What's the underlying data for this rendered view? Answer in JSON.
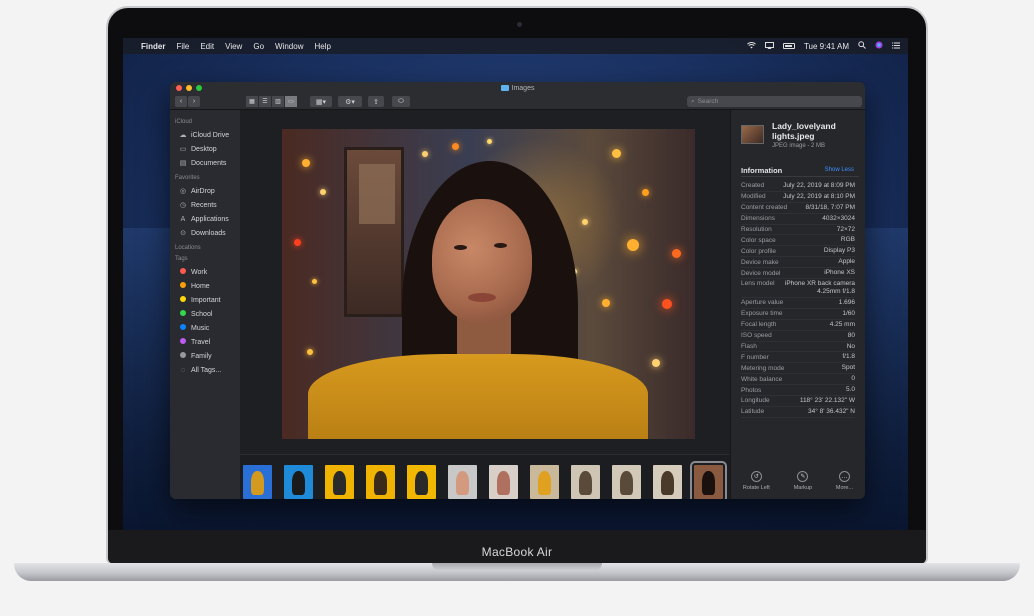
{
  "menubar": {
    "app": "Finder",
    "items": [
      "File",
      "Edit",
      "View",
      "Go",
      "Window",
      "Help"
    ],
    "time": "Tue 9:41 AM"
  },
  "window": {
    "title": "Images",
    "search_placeholder": "Search"
  },
  "sidebar": {
    "icloud_header": "iCloud",
    "icloud": [
      "iCloud Drive",
      "Desktop",
      "Documents"
    ],
    "favorites_header": "Favorites",
    "favorites": [
      "AirDrop",
      "Recents",
      "Applications",
      "Downloads"
    ],
    "locations_header": "Locations",
    "tags_header": "Tags",
    "tags": [
      {
        "label": "Work",
        "color": "#ff5a52"
      },
      {
        "label": "Home",
        "color": "#ff9f0a"
      },
      {
        "label": "Important",
        "color": "#ffd60a"
      },
      {
        "label": "School",
        "color": "#32d74b"
      },
      {
        "label": "Music",
        "color": "#0a84ff"
      },
      {
        "label": "Travel",
        "color": "#bf5af2"
      },
      {
        "label": "Family",
        "color": "#98989d"
      },
      {
        "label": "All Tags...",
        "color": ""
      }
    ]
  },
  "inspector": {
    "file_name": "Lady_lovelyand lights.jpeg",
    "file_type": "JPEG image - 2 MB",
    "info_header": "Information",
    "show_less": "Show Less",
    "rows": [
      {
        "k": "Created",
        "v": "July 22, 2019 at 8:09 PM"
      },
      {
        "k": "Modified",
        "v": "July 22, 2019 at 8:10 PM"
      },
      {
        "k": "Content created",
        "v": "8/31/18, 7:07 PM"
      },
      {
        "k": "Dimensions",
        "v": "4032×3024"
      },
      {
        "k": "Resolution",
        "v": "72×72"
      },
      {
        "k": "Color space",
        "v": "RGB"
      },
      {
        "k": "Color profile",
        "v": "Display P3"
      },
      {
        "k": "Device make",
        "v": "Apple"
      },
      {
        "k": "Device model",
        "v": "iPhone XS"
      },
      {
        "k": "Lens model",
        "v": "iPhone XR back camera 4.25mm f/1.8"
      },
      {
        "k": "Aperture value",
        "v": "1.696"
      },
      {
        "k": "Exposure time",
        "v": "1/60"
      },
      {
        "k": "Focal length",
        "v": "4.25 mm"
      },
      {
        "k": "ISO speed",
        "v": "80"
      },
      {
        "k": "Flash",
        "v": "No"
      },
      {
        "k": "F number",
        "v": "f/1.8"
      },
      {
        "k": "Metering mode",
        "v": "Spot"
      },
      {
        "k": "White balance",
        "v": "0"
      },
      {
        "k": "Photos",
        "v": "5.0"
      },
      {
        "k": "Longitude",
        "v": "118° 23' 22.132\" W"
      },
      {
        "k": "Latitude",
        "v": "34° 8' 36.432\" N"
      }
    ],
    "actions": [
      "Rotate Left",
      "Markup",
      "More..."
    ]
  },
  "laptop": {
    "model": "MacBook Air"
  },
  "thumbnails": [
    {
      "bg": "#2a6fd6",
      "fg": "#d49a20"
    },
    {
      "bg": "#1e8ad8",
      "fg": "#1a1a1a"
    },
    {
      "bg": "#f0b400",
      "fg": "#2a2a2a"
    },
    {
      "bg": "#f0b400",
      "fg": "#3a2a1a"
    },
    {
      "bg": "#f2b800",
      "fg": "#2a2a2a"
    },
    {
      "bg": "#c8c8c8",
      "fg": "#d49a80"
    },
    {
      "bg": "#d8d0c8",
      "fg": "#b07060"
    },
    {
      "bg": "#c9b89a",
      "fg": "#e0a020"
    },
    {
      "bg": "#cfc5b5",
      "fg": "#5a4a3a"
    },
    {
      "bg": "#d2c8b8",
      "fg": "#5a4a3a"
    },
    {
      "bg": "#d6ccbc",
      "fg": "#4a3a2a"
    },
    {
      "bg": "#8a5a40",
      "fg": "#1a100d"
    }
  ]
}
